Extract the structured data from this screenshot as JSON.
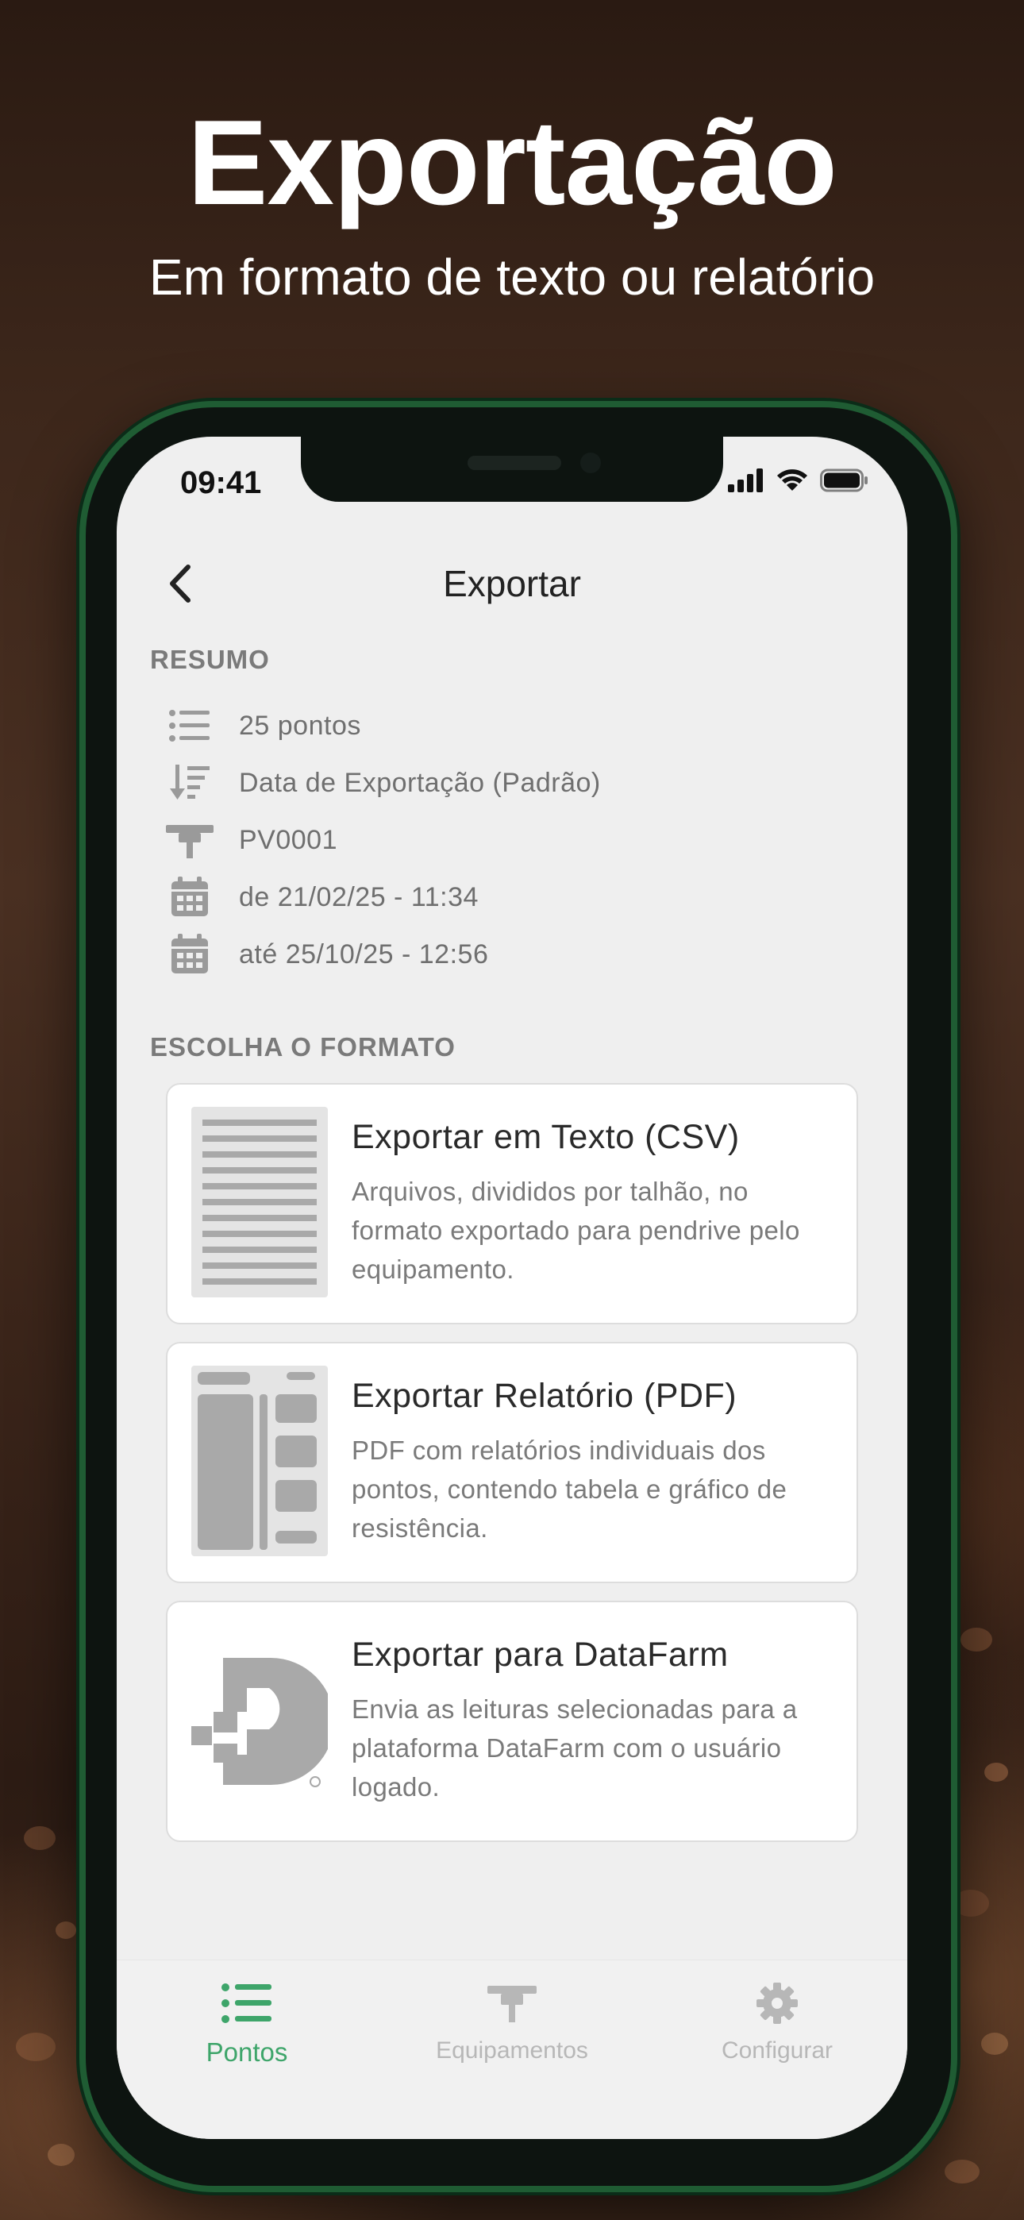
{
  "hero": {
    "title": "Exportação",
    "subtitle": "Em formato de texto ou relatório"
  },
  "status_bar": {
    "time": "09:41"
  },
  "nav": {
    "title": "Exportar",
    "back_icon": "chevron-left-icon"
  },
  "summary": {
    "label": "RESUMO",
    "items": [
      {
        "icon": "list-icon",
        "text": "25 pontos"
      },
      {
        "icon": "sort-icon",
        "text": "Data de Exportação (Padrão)"
      },
      {
        "icon": "probe-icon",
        "text": "PV0001"
      },
      {
        "icon": "calendar-icon",
        "text": "de 21/02/25 - 11:34"
      },
      {
        "icon": "calendar-icon",
        "text": "até 25/10/25 - 12:56"
      }
    ]
  },
  "formats": {
    "label": "ESCOLHA O FORMATO",
    "cards": [
      {
        "icon": "csv-document-icon",
        "title": "Exportar em Texto (CSV)",
        "description": "Arquivos, divididos por talhão, no formato exportado para pendrive pelo equipamento."
      },
      {
        "icon": "pdf-report-icon",
        "title": "Exportar Relatório (PDF)",
        "description": "PDF com relatórios individuais dos pontos, contendo tabela e gráfico de resistência."
      },
      {
        "icon": "datafarm-logo-icon",
        "title": "Exportar para DataFarm",
        "description": "Envia as leituras selecionadas para a plataforma DataFarm com o usuário logado."
      }
    ]
  },
  "tabbar": {
    "tabs": [
      {
        "label": "Pontos",
        "icon": "list-icon",
        "active": true
      },
      {
        "label": "Equipamentos",
        "icon": "probe-icon",
        "active": false
      },
      {
        "label": "Configurar",
        "icon": "gear-icon",
        "active": false
      }
    ]
  },
  "colors": {
    "accent": "#3ea56a",
    "inactive": "#b7b7b7",
    "frame": "#1f5c33"
  }
}
